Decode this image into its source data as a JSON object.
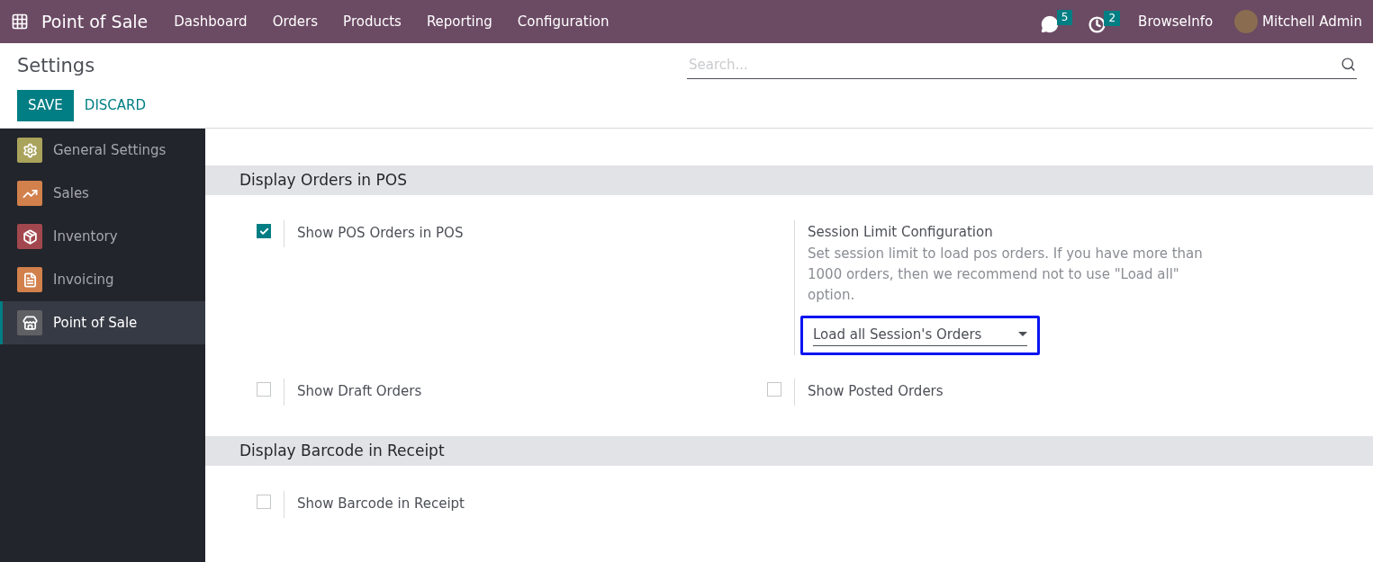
{
  "navbar": {
    "app_name": "Point of Sale",
    "menu": [
      "Dashboard",
      "Orders",
      "Products",
      "Reporting",
      "Configuration"
    ],
    "messages_count": "5",
    "activities_count": "2",
    "company": "BrowseInfo",
    "user": "Mitchell Admin"
  },
  "control_panel": {
    "title": "Settings",
    "search": {
      "placeholder": "Search..."
    },
    "buttons": [
      "SAVE",
      "DISCARD"
    ]
  },
  "sidebar": {
    "items": [
      {
        "label": "General Settings",
        "color": "#a9a35c",
        "kind": "gear",
        "selected": false
      },
      {
        "label": "Sales",
        "color": "#d2804c",
        "kind": "chart",
        "selected": false
      },
      {
        "label": "Inventory",
        "color": "#a3474e",
        "kind": "box",
        "selected": false
      },
      {
        "label": "Invoicing",
        "color": "#d2804c",
        "kind": "invoice",
        "selected": false
      },
      {
        "label": "Point of Sale",
        "color": "#5f6063",
        "kind": "store",
        "selected": true
      }
    ]
  },
  "sections": [
    {
      "title": "Display Orders in POS",
      "settings": [
        {
          "kind": "checkbox",
          "label": "Show POS Orders in POS",
          "checked": true
        },
        {
          "kind": "select",
          "label": "Session Limit Configuration",
          "description": "Set session limit to load pos orders. If you have more than 1000 orders, then we recommend not to use \"Load all\" option.",
          "value": "Load all Session's Orders",
          "highlighted": true
        },
        {
          "kind": "checkbox",
          "label": "Show Draft Orders",
          "checked": false
        },
        {
          "kind": "checkbox",
          "label": "Show Posted Orders",
          "checked": false
        }
      ]
    },
    {
      "title": "Display Barcode in Receipt",
      "settings": [
        {
          "kind": "checkbox",
          "label": "Show Barcode in Receipt",
          "checked": false
        }
      ]
    }
  ]
}
